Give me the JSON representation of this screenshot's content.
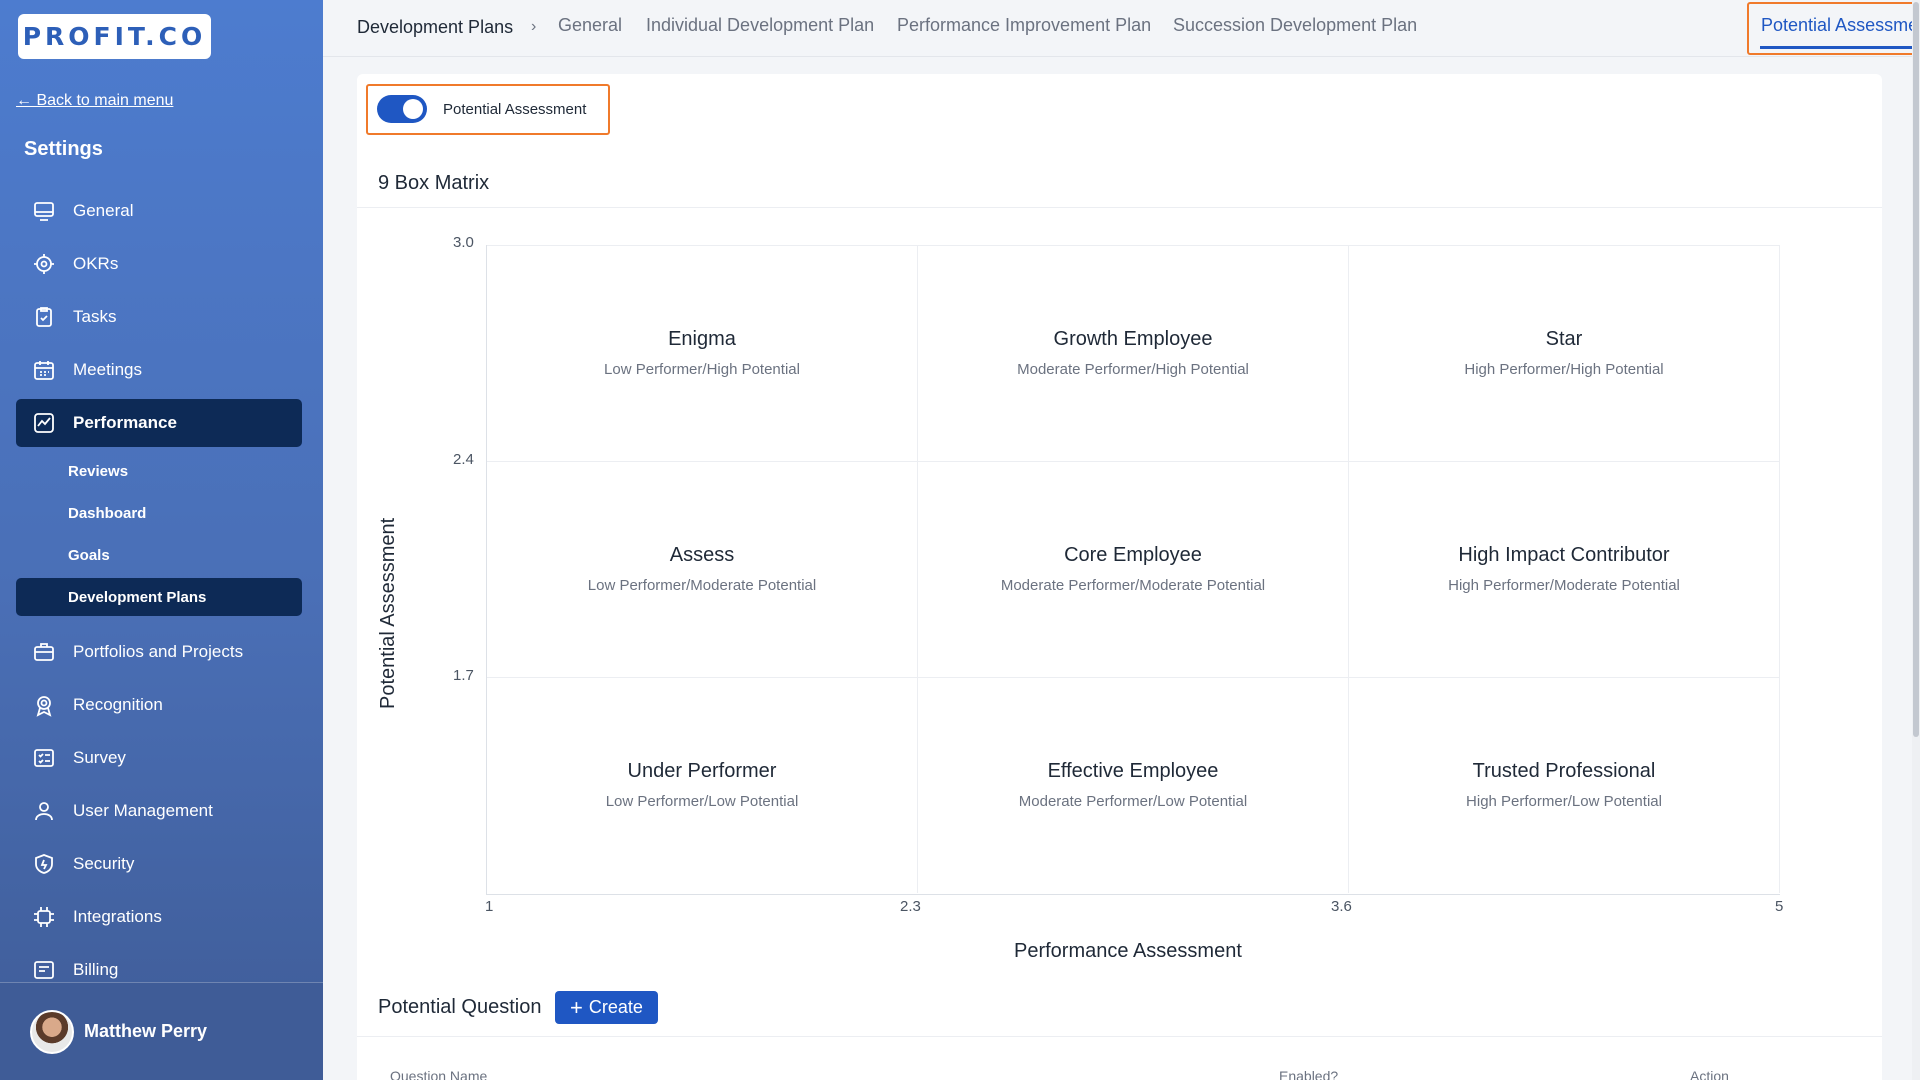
{
  "brand": {
    "logo_text": "PROFIT.CO",
    "accent": "#1f57c3",
    "highlight": "#f07a2b"
  },
  "sidebar": {
    "back_label": "← Back to main menu",
    "title": "Settings",
    "items": [
      {
        "label": "General",
        "icon": "monitor-icon"
      },
      {
        "label": "OKRs",
        "icon": "target-icon"
      },
      {
        "label": "Tasks",
        "icon": "clipboard-check-icon"
      },
      {
        "label": "Meetings",
        "icon": "calendar-icon"
      },
      {
        "label": "Performance",
        "icon": "chart-line-icon",
        "active": true
      },
      {
        "label": "Portfolios and Projects",
        "icon": "briefcase-icon"
      },
      {
        "label": "Recognition",
        "icon": "badge-icon"
      },
      {
        "label": "Survey",
        "icon": "survey-icon"
      },
      {
        "label": "User Management",
        "icon": "user-icon"
      },
      {
        "label": "Security",
        "icon": "shield-icon"
      },
      {
        "label": "Integrations",
        "icon": "chip-icon"
      },
      {
        "label": "Billing",
        "icon": "billing-icon"
      }
    ],
    "performance_sub": [
      "Reviews",
      "Dashboard",
      "Goals",
      "Development Plans"
    ],
    "user": {
      "name": "Matthew Perry"
    }
  },
  "topbar": {
    "breadcrumb": "Development Plans",
    "separator": "›",
    "tabs": [
      "General",
      "Individual Development Plan",
      "Performance Improvement Plan",
      "Succession Development Plan",
      "Potential Assessment"
    ],
    "active_tab": "Potential Assessment"
  },
  "main": {
    "toggle_label": "Potential Assessment",
    "toggle_on": true,
    "matrix_title": "9 Box Matrix",
    "y_axis_label": "Potential Assessment",
    "x_axis_label": "Performance Assessment",
    "y_ticks": [
      "3.0",
      "2.4",
      "1.7"
    ],
    "x_ticks": [
      "1",
      "2.3",
      "3.6",
      "5"
    ],
    "cells": [
      {
        "title": "Enigma",
        "subtitle": "Low Performer/High Potential"
      },
      {
        "title": "Growth Employee",
        "subtitle": "Moderate Performer/High Potential"
      },
      {
        "title": "Star",
        "subtitle": "High Performer/High Potential"
      },
      {
        "title": "Assess",
        "subtitle": "Low Performer/Moderate Potential"
      },
      {
        "title": "Core Employee",
        "subtitle": "Moderate Performer/Moderate Potential"
      },
      {
        "title": "High Impact Contributor",
        "subtitle": "High Performer/Moderate Potential"
      },
      {
        "title": "Under Performer",
        "subtitle": "Low Performer/Low Potential"
      },
      {
        "title": "Effective Employee",
        "subtitle": "Moderate Performer/Low Potential"
      },
      {
        "title": "Trusted Professional",
        "subtitle": "High Performer/Low Potential"
      }
    ],
    "question_section_title": "Potential Question",
    "create_label": "Create",
    "table_headers": [
      "Question Name",
      "Enabled?",
      "Action"
    ]
  }
}
